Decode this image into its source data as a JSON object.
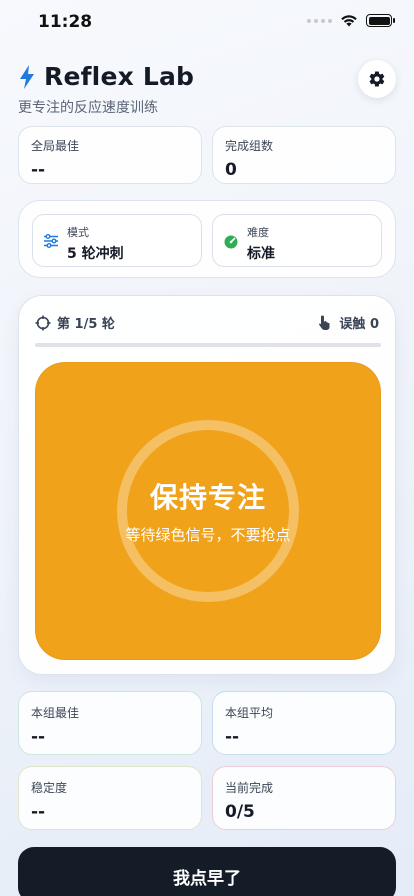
{
  "status_bar": {
    "time": "11:28"
  },
  "header": {
    "title": "Reflex Lab",
    "subtitle": "更专注的反应速度训练"
  },
  "top_stats": [
    {
      "label": "全局最佳",
      "value": "--"
    },
    {
      "label": "完成组数",
      "value": "0"
    }
  ],
  "options": {
    "mode": {
      "label": "模式",
      "value": "5 轮冲刺"
    },
    "difficulty": {
      "label": "难度",
      "value": "标准"
    }
  },
  "game": {
    "round": "第 1/5 轮",
    "misses": "误触 0",
    "progress": 0,
    "pad_title": "保持专注",
    "pad_subtitle": "等待绿色信号，不要抢点",
    "pad_color": "#F0A21A"
  },
  "bottom_stats": [
    {
      "label": "本组最佳",
      "value": "--"
    },
    {
      "label": "本组平均",
      "value": "--"
    },
    {
      "label": "稳定度",
      "value": "--"
    },
    {
      "label": "当前完成",
      "value": "0/5"
    }
  ],
  "action": {
    "label": "我点早了"
  },
  "colors": {
    "accent": "#1F7AE0",
    "pad": "#F0A21A",
    "dark_button": "#141C28"
  }
}
